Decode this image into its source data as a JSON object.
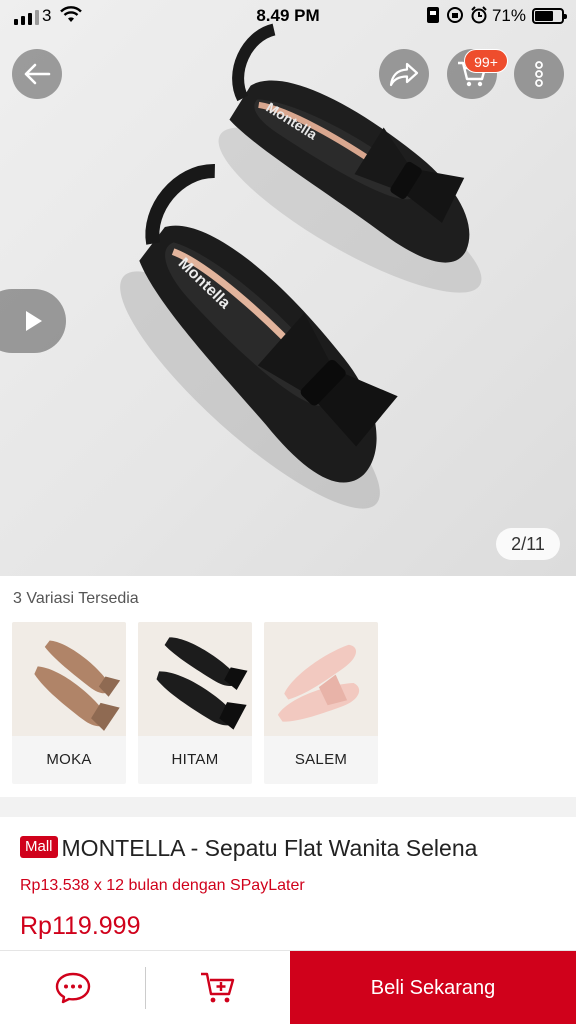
{
  "status_bar": {
    "carrier": "3",
    "time": "8.49 PM",
    "battery_percent": "71%",
    "battery_level": 0.71
  },
  "header": {
    "cart_badge": "99+"
  },
  "gallery": {
    "page_indicator": "2/11"
  },
  "variations": {
    "title": "3 Variasi Tersedia",
    "items": [
      {
        "label": "MOKA",
        "color": "#b08468"
      },
      {
        "label": "HITAM",
        "color": "#1c1c1c"
      },
      {
        "label": "SALEM",
        "color": "#f2c9c0"
      }
    ]
  },
  "product": {
    "mall_badge": "Mall",
    "title": "MONTELLA - Sepatu Flat Wanita Selena",
    "installment": "Rp13.538 x 12 bulan dengan SPayLater",
    "price": "Rp119.999"
  },
  "bottom_bar": {
    "buy_label": "Beli Sekarang"
  },
  "colors": {
    "accent": "#d0011b",
    "badge": "#ee4d2d"
  }
}
